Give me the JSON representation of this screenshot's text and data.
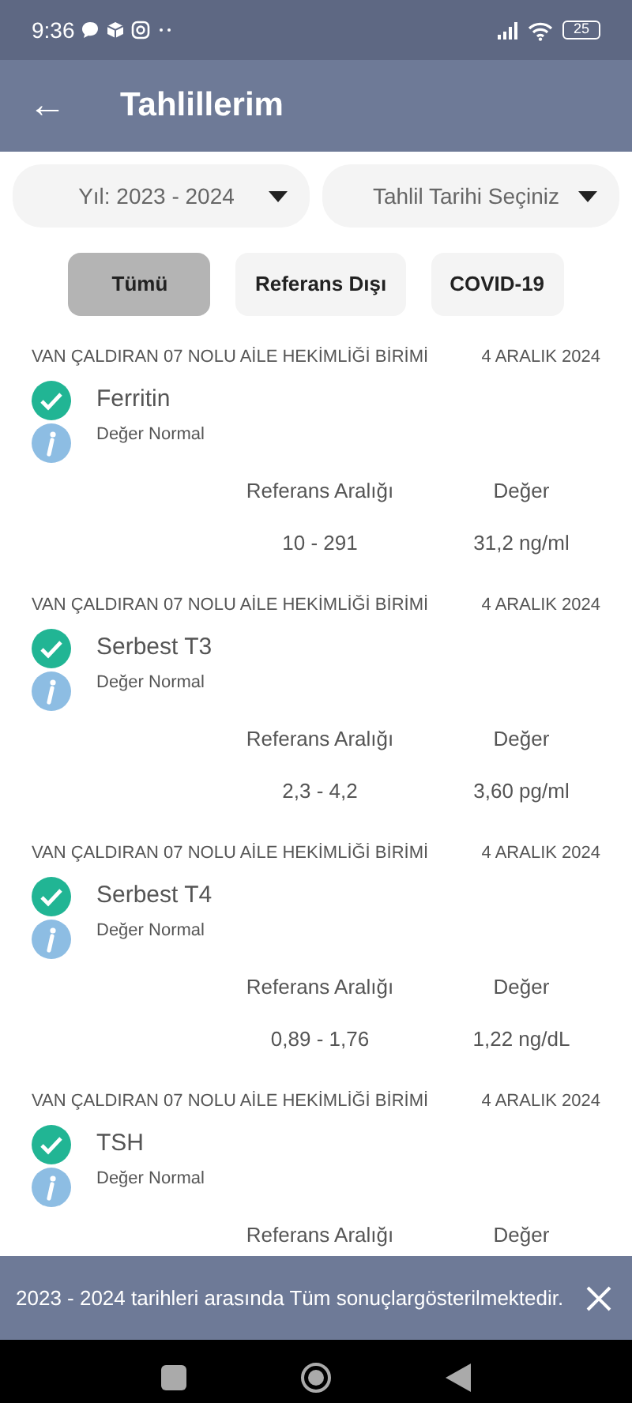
{
  "status_bar": {
    "time": "9:36",
    "battery": "25"
  },
  "app_bar": {
    "back": "←",
    "title": "Tahlillerim"
  },
  "dropdowns": [
    {
      "value": "Yıl: 2023 - 2024"
    },
    {
      "value": "Tahlil Tarihi Seçiniz"
    }
  ],
  "filters": [
    {
      "label": "Tümü",
      "selected": true
    },
    {
      "label": "Referans Dışı",
      "selected": false
    },
    {
      "label": "COVID-19",
      "selected": false
    }
  ],
  "results": [
    {
      "facility": "VAN ÇALDIRAN 07 NOLU AİLE HEKİMLİĞİ BİRİMİ",
      "date": "4 ARALIK 2024",
      "test": "Ferritin",
      "status": "Değer Normal",
      "range_label": "Referans Aralığı",
      "value_label": "Değer",
      "range": "10 - 291",
      "value": "31,2 ng/ml"
    },
    {
      "facility": "VAN ÇALDIRAN 07 NOLU AİLE HEKİMLİĞİ BİRİMİ",
      "date": "4 ARALIK 2024",
      "test": "Serbest T3",
      "status": "Değer Normal",
      "range_label": "Referans Aralığı",
      "value_label": "Değer",
      "range": "2,3 - 4,2",
      "value": "3,60 pg/ml"
    },
    {
      "facility": "VAN ÇALDIRAN 07 NOLU AİLE HEKİMLİĞİ BİRİMİ",
      "date": "4 ARALIK 2024",
      "test": "Serbest T4",
      "status": "Değer Normal",
      "range_label": "Referans Aralığı",
      "value_label": "Değer",
      "range": "0,89 - 1,76",
      "value": "1,22 ng/dL"
    },
    {
      "facility": "VAN ÇALDIRAN 07 NOLU AİLE HEKİMLİĞİ BİRİMİ",
      "date": "4 ARALIK 2024",
      "test": "TSH",
      "status": "Değer Normal",
      "range_label": "Referans Aralığı",
      "value_label": "Değer"
    }
  ],
  "snackbar": {
    "message": "2023 - 2024 tarihleri arasında Tüm sonuçlargösterilmektedir."
  }
}
